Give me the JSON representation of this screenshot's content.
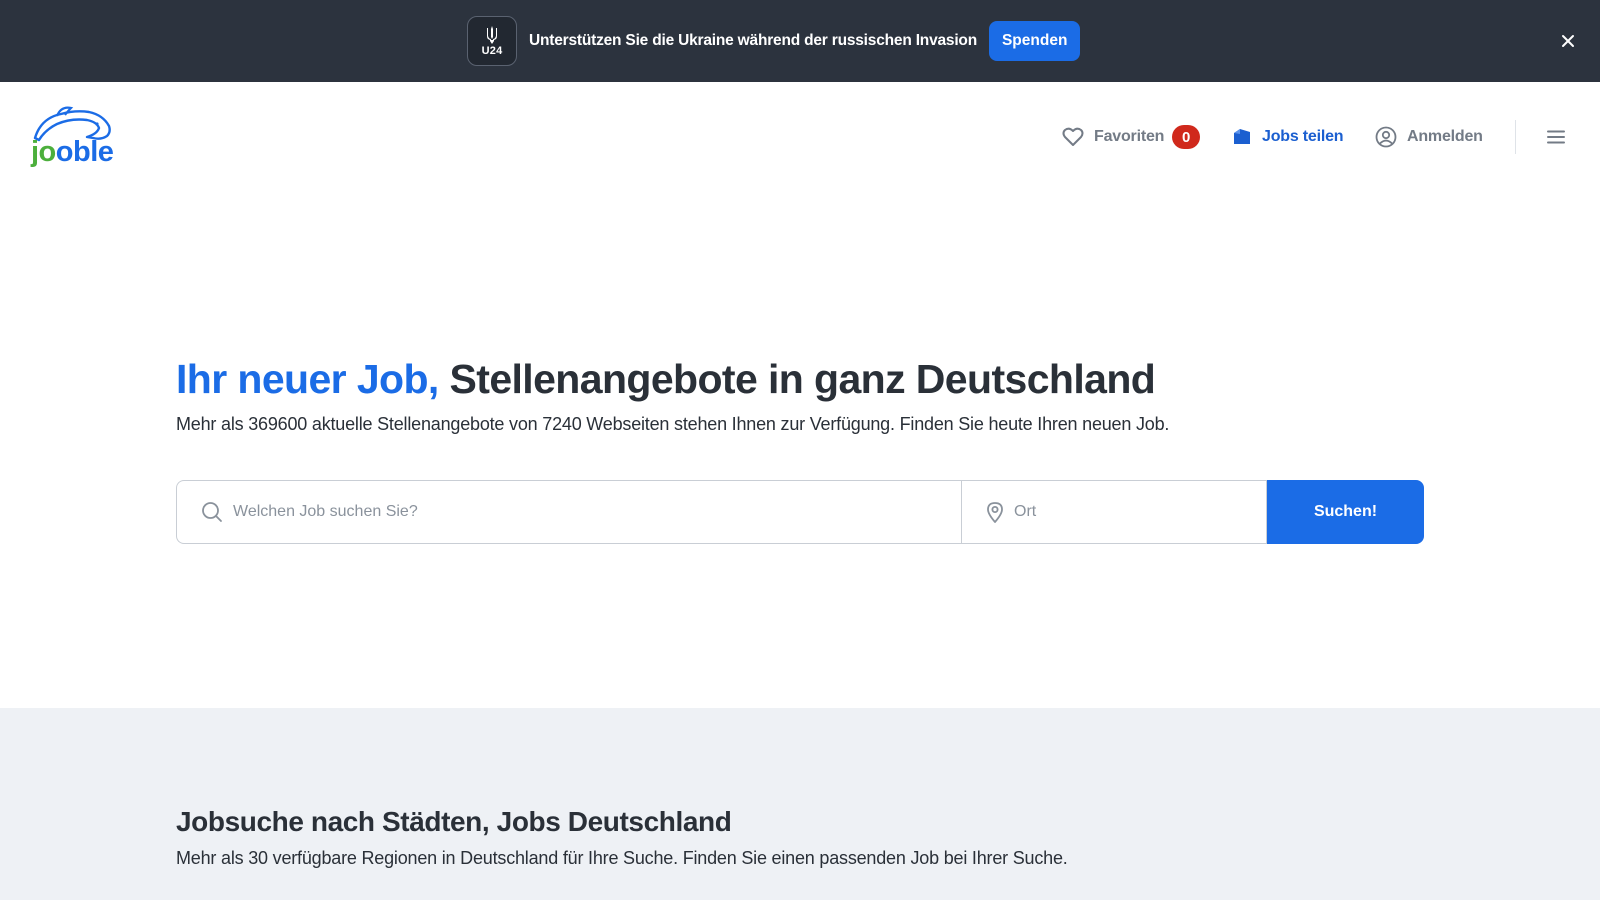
{
  "banner": {
    "logo_text": "U24",
    "logo_icon": "trident-icon",
    "message": "Unterstützen Sie die Ukraine während der russischen Invasion",
    "donate_label": "Spenden",
    "close_icon": "close-icon"
  },
  "header": {
    "logo": {
      "part_green": "jo",
      "part_blue": "oble"
    },
    "nav": {
      "favorites": {
        "label": "Favoriten",
        "count": "0",
        "icon": "heart-icon"
      },
      "share": {
        "label": "Jobs teilen",
        "icon": "share-jobs-icon"
      },
      "login": {
        "label": "Anmelden",
        "icon": "user-circle-icon"
      },
      "menu_icon": "hamburger-menu-icon"
    }
  },
  "hero": {
    "title_accent": "Ihr neuer Job,",
    "title_rest": "Stellenangebote in ganz Deutschland",
    "subtitle": "Mehr als 369600 aktuelle Stellenangebote von 7240 Webseiten stehen Ihnen zur Verfügung. Finden Sie heute Ihren neuen Job.",
    "search": {
      "job_placeholder": "Welchen Job suchen Sie?",
      "job_value": "",
      "location_placeholder": "Ort",
      "location_value": "",
      "submit_label": "Suchen!"
    }
  },
  "cities": {
    "title": "Jobsuche nach Städten, Jobs Deutschland",
    "subtitle": "Mehr als 30 verfügbare Regionen in Deutschland für Ihre Suche. Finden Sie einen passenden Job bei Ihrer Suche."
  },
  "colors": {
    "banner_bg": "#2c333e",
    "accent_blue": "#1b6ce6",
    "badge_red": "#d0291c",
    "logo_green": "#4caf3c",
    "section_bg": "#eef1f5"
  }
}
